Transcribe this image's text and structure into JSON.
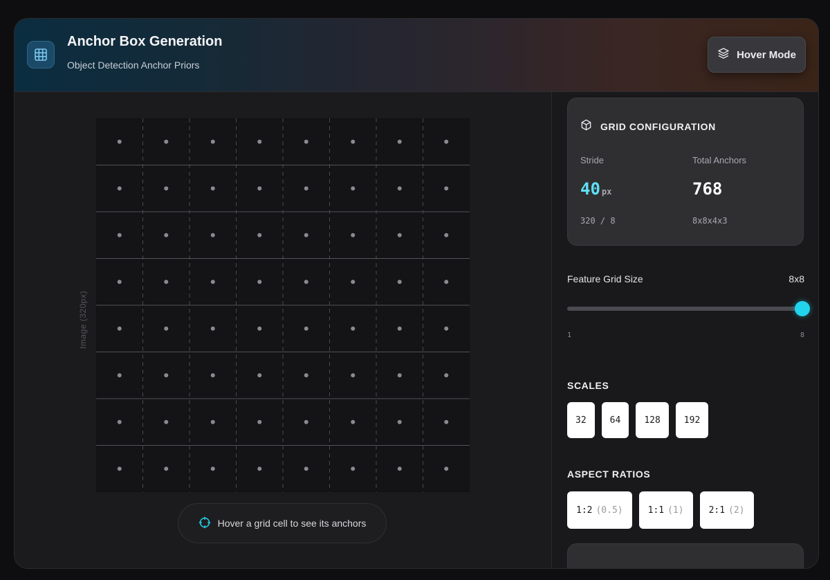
{
  "header": {
    "title": "Anchor Box Generation",
    "subtitle": "Object Detection Anchor Priors",
    "mode_button_label": "Hover Mode"
  },
  "canvas": {
    "image_label": "Image (320px)",
    "grid_size": 8,
    "hint": "Hover a grid cell to see its anchors"
  },
  "config": {
    "title": "GRID CONFIGURATION",
    "stride": {
      "label": "Stride",
      "value": "40",
      "unit": "px",
      "formula": "320 / 8"
    },
    "total_anchors": {
      "label": "Total Anchors",
      "value": "768",
      "formula": "8x8x4x3"
    }
  },
  "grid_slider": {
    "label": "Feature Grid Size",
    "value_text": "8x8",
    "min": 1,
    "max": 8,
    "value": 8,
    "min_label": "1",
    "max_label": "8"
  },
  "scales": {
    "title": "SCALES",
    "items": [
      "32",
      "64",
      "128",
      "192"
    ]
  },
  "aspect_ratios": {
    "title": "ASPECT RATIOS",
    "items": [
      {
        "label": "1:2",
        "value": "(0.5)"
      },
      {
        "label": "1:1",
        "value": "(1)"
      },
      {
        "label": "2:1",
        "value": "(2)"
      }
    ]
  },
  "colors": {
    "accent": "#22d3ee",
    "chip_bg": "#ffffff",
    "card_bg": "#2f2f32"
  }
}
